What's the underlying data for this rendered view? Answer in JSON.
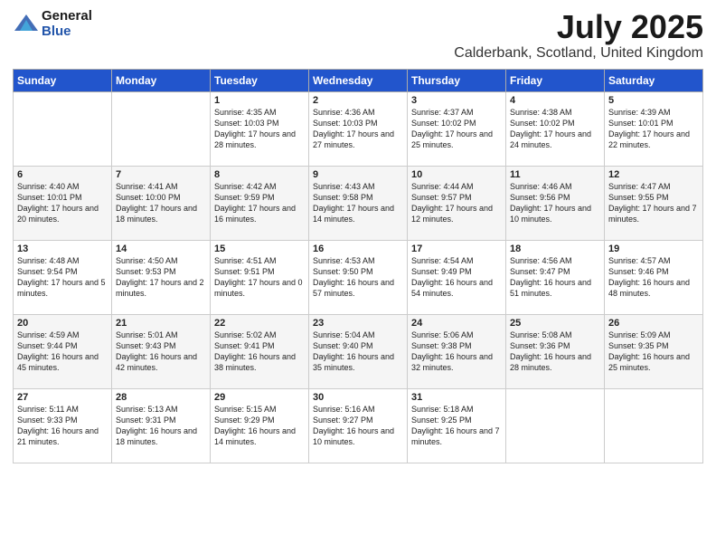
{
  "header": {
    "logo_general": "General",
    "logo_blue": "Blue",
    "title": "July 2025",
    "subtitle": "Calderbank, Scotland, United Kingdom"
  },
  "days_of_week": [
    "Sunday",
    "Monday",
    "Tuesday",
    "Wednesday",
    "Thursday",
    "Friday",
    "Saturday"
  ],
  "weeks": [
    [
      {
        "day": "",
        "info": ""
      },
      {
        "day": "",
        "info": ""
      },
      {
        "day": "1",
        "info": "Sunrise: 4:35 AM\nSunset: 10:03 PM\nDaylight: 17 hours and 28 minutes."
      },
      {
        "day": "2",
        "info": "Sunrise: 4:36 AM\nSunset: 10:03 PM\nDaylight: 17 hours and 27 minutes."
      },
      {
        "day": "3",
        "info": "Sunrise: 4:37 AM\nSunset: 10:02 PM\nDaylight: 17 hours and 25 minutes."
      },
      {
        "day": "4",
        "info": "Sunrise: 4:38 AM\nSunset: 10:02 PM\nDaylight: 17 hours and 24 minutes."
      },
      {
        "day": "5",
        "info": "Sunrise: 4:39 AM\nSunset: 10:01 PM\nDaylight: 17 hours and 22 minutes."
      }
    ],
    [
      {
        "day": "6",
        "info": "Sunrise: 4:40 AM\nSunset: 10:01 PM\nDaylight: 17 hours and 20 minutes."
      },
      {
        "day": "7",
        "info": "Sunrise: 4:41 AM\nSunset: 10:00 PM\nDaylight: 17 hours and 18 minutes."
      },
      {
        "day": "8",
        "info": "Sunrise: 4:42 AM\nSunset: 9:59 PM\nDaylight: 17 hours and 16 minutes."
      },
      {
        "day": "9",
        "info": "Sunrise: 4:43 AM\nSunset: 9:58 PM\nDaylight: 17 hours and 14 minutes."
      },
      {
        "day": "10",
        "info": "Sunrise: 4:44 AM\nSunset: 9:57 PM\nDaylight: 17 hours and 12 minutes."
      },
      {
        "day": "11",
        "info": "Sunrise: 4:46 AM\nSunset: 9:56 PM\nDaylight: 17 hours and 10 minutes."
      },
      {
        "day": "12",
        "info": "Sunrise: 4:47 AM\nSunset: 9:55 PM\nDaylight: 17 hours and 7 minutes."
      }
    ],
    [
      {
        "day": "13",
        "info": "Sunrise: 4:48 AM\nSunset: 9:54 PM\nDaylight: 17 hours and 5 minutes."
      },
      {
        "day": "14",
        "info": "Sunrise: 4:50 AM\nSunset: 9:53 PM\nDaylight: 17 hours and 2 minutes."
      },
      {
        "day": "15",
        "info": "Sunrise: 4:51 AM\nSunset: 9:51 PM\nDaylight: 17 hours and 0 minutes."
      },
      {
        "day": "16",
        "info": "Sunrise: 4:53 AM\nSunset: 9:50 PM\nDaylight: 16 hours and 57 minutes."
      },
      {
        "day": "17",
        "info": "Sunrise: 4:54 AM\nSunset: 9:49 PM\nDaylight: 16 hours and 54 minutes."
      },
      {
        "day": "18",
        "info": "Sunrise: 4:56 AM\nSunset: 9:47 PM\nDaylight: 16 hours and 51 minutes."
      },
      {
        "day": "19",
        "info": "Sunrise: 4:57 AM\nSunset: 9:46 PM\nDaylight: 16 hours and 48 minutes."
      }
    ],
    [
      {
        "day": "20",
        "info": "Sunrise: 4:59 AM\nSunset: 9:44 PM\nDaylight: 16 hours and 45 minutes."
      },
      {
        "day": "21",
        "info": "Sunrise: 5:01 AM\nSunset: 9:43 PM\nDaylight: 16 hours and 42 minutes."
      },
      {
        "day": "22",
        "info": "Sunrise: 5:02 AM\nSunset: 9:41 PM\nDaylight: 16 hours and 38 minutes."
      },
      {
        "day": "23",
        "info": "Sunrise: 5:04 AM\nSunset: 9:40 PM\nDaylight: 16 hours and 35 minutes."
      },
      {
        "day": "24",
        "info": "Sunrise: 5:06 AM\nSunset: 9:38 PM\nDaylight: 16 hours and 32 minutes."
      },
      {
        "day": "25",
        "info": "Sunrise: 5:08 AM\nSunset: 9:36 PM\nDaylight: 16 hours and 28 minutes."
      },
      {
        "day": "26",
        "info": "Sunrise: 5:09 AM\nSunset: 9:35 PM\nDaylight: 16 hours and 25 minutes."
      }
    ],
    [
      {
        "day": "27",
        "info": "Sunrise: 5:11 AM\nSunset: 9:33 PM\nDaylight: 16 hours and 21 minutes."
      },
      {
        "day": "28",
        "info": "Sunrise: 5:13 AM\nSunset: 9:31 PM\nDaylight: 16 hours and 18 minutes."
      },
      {
        "day": "29",
        "info": "Sunrise: 5:15 AM\nSunset: 9:29 PM\nDaylight: 16 hours and 14 minutes."
      },
      {
        "day": "30",
        "info": "Sunrise: 5:16 AM\nSunset: 9:27 PM\nDaylight: 16 hours and 10 minutes."
      },
      {
        "day": "31",
        "info": "Sunrise: 5:18 AM\nSunset: 9:25 PM\nDaylight: 16 hours and 7 minutes."
      },
      {
        "day": "",
        "info": ""
      },
      {
        "day": "",
        "info": ""
      }
    ]
  ]
}
